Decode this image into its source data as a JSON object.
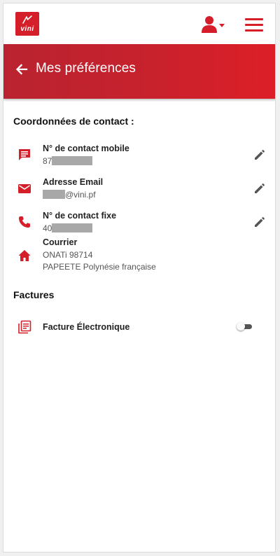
{
  "header": {
    "logo_text": "vini",
    "user_menu": "user-icon",
    "main_menu": "hamburger-icon"
  },
  "page": {
    "title": "Mes préférences",
    "back": "arrow-back-icon"
  },
  "contact": {
    "section_title": "Coordonnées de contact :",
    "mobile": {
      "label": "N° de contact mobile",
      "value_prefix": "87",
      "icon": "message-icon"
    },
    "email": {
      "label": "Adresse Email",
      "value_suffix": "@vini.pf",
      "icon": "mail-icon"
    },
    "fixe": {
      "label": "N° de contact fixe",
      "value_prefix": "40",
      "icon": "phone-icon"
    },
    "courrier": {
      "label": "Courrier",
      "line1": "ONATi 98714",
      "line2": "PAPEETE Polynésie française",
      "icon": "home-icon"
    }
  },
  "factures": {
    "section_title": "Factures",
    "electronique": {
      "label": "Facture Électronique",
      "enabled": false,
      "icon": "receipt-icon"
    }
  },
  "colors": {
    "brand": "#d41f2a",
    "banner_start": "#b9232f",
    "banner_end": "#dd1f27",
    "icon_grey": "#555555"
  }
}
